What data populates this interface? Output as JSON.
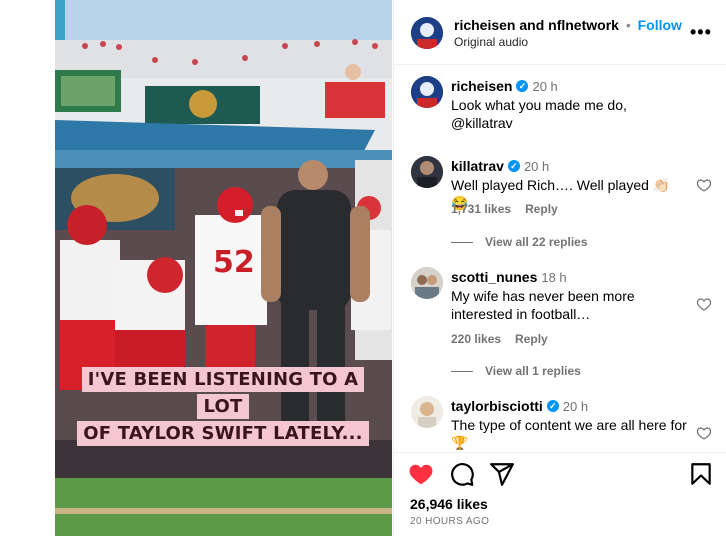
{
  "post": {
    "author": "richeisen",
    "and_text": "and",
    "coauthor": "nflnetwork",
    "separator": "•",
    "follow_label": "Follow",
    "audio": "Original audio",
    "more_glyph": "•••"
  },
  "video": {
    "caption_line1": "I'VE BEEN LISTENING TO A LOT",
    "caption_line2": "OF TAYLOR SWIFT LATELY...",
    "jersey_number": "52"
  },
  "comments": [
    {
      "user": "richeisen",
      "verified": true,
      "time": "20 h",
      "text": "Look what you made me do, @killatrav"
    },
    {
      "user": "killatrav",
      "verified": true,
      "time": "20 h",
      "text": "Well played Rich…. Well played 👏🏻😂",
      "likes": "1,731 likes",
      "reply": "Reply",
      "view_replies": "View all 22 replies"
    },
    {
      "user": "scotti_nunes",
      "verified": false,
      "time": "18 h",
      "text": "My wife has never been more interested in football…",
      "likes": "220 likes",
      "reply": "Reply",
      "view_replies": "View all 1 replies"
    },
    {
      "user": "taylorbisciotti",
      "verified": true,
      "time": "20 h",
      "text": "The type of content we are all here for 🏆"
    }
  ],
  "footer": {
    "likes": "26,946 likes",
    "time_ago": "20 HOURS AGO"
  },
  "colors": {
    "accent": "#0095f6",
    "heart": "#ff3040",
    "caption_bg": "#f3c6d2"
  }
}
